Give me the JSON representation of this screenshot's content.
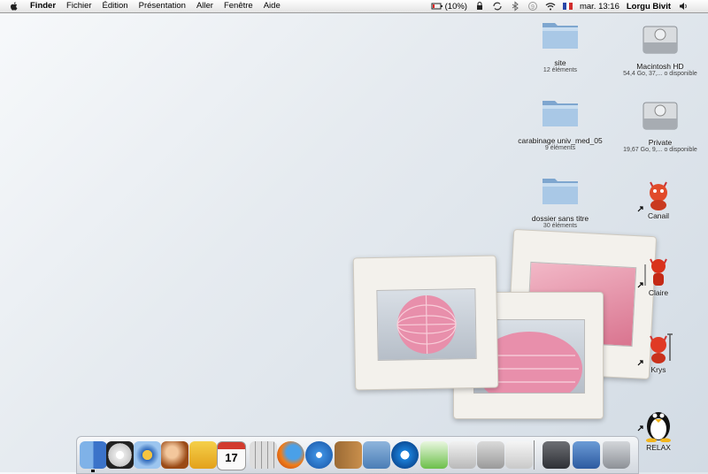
{
  "menubar": {
    "app": "Finder",
    "items": [
      "Fichier",
      "Édition",
      "Présentation",
      "Aller",
      "Fenêtre",
      "Aide"
    ],
    "battery": "(10%)",
    "clock": "mar. 13:16",
    "user": "Lorgu Bivit"
  },
  "desktop": {
    "folders": [
      {
        "name": "site",
        "count": "12 éléments"
      },
      {
        "name": "carabinage univ_med_05",
        "count": "9 éléments"
      },
      {
        "name": "dossier sans titre",
        "count": "30 éléments"
      }
    ],
    "disks": [
      {
        "name": "Macintosh HD",
        "info": "54,4 Go, 37,... o disponible"
      },
      {
        "name": "Private",
        "info": "19,67 Go, 9,... o disponible"
      }
    ],
    "aliases": [
      {
        "name": "Canail",
        "icon": "devil-icon"
      },
      {
        "name": "Claire",
        "icon": "devil-icon"
      },
      {
        "name": "Krys",
        "icon": "devil-icon"
      },
      {
        "name": "RELAX",
        "icon": "tux-penguin-icon"
      }
    ]
  },
  "dock": {
    "apps": [
      "finder-icon",
      "dashboard-icon",
      "itunes-eye-icon",
      "photo-icon",
      "euro-calculator-icon",
      "ical-icon",
      "calculator-icon",
      "firefox-icon",
      "safari-icon",
      "address-book-icon",
      "mail-icon",
      "quicktime-icon",
      "itunes-icon",
      "preview-icon",
      "system-prefs-icon",
      "apple-icon"
    ],
    "right": [
      "applications-folder-icon",
      "documents-icon",
      "trash-icon"
    ]
  },
  "colors": {
    "desktop_top": "#f7f9fb",
    "desktop_bottom": "#d2dbe4",
    "folder_blue": "#8fb6dd",
    "lantern_pink": "#e88fab"
  }
}
